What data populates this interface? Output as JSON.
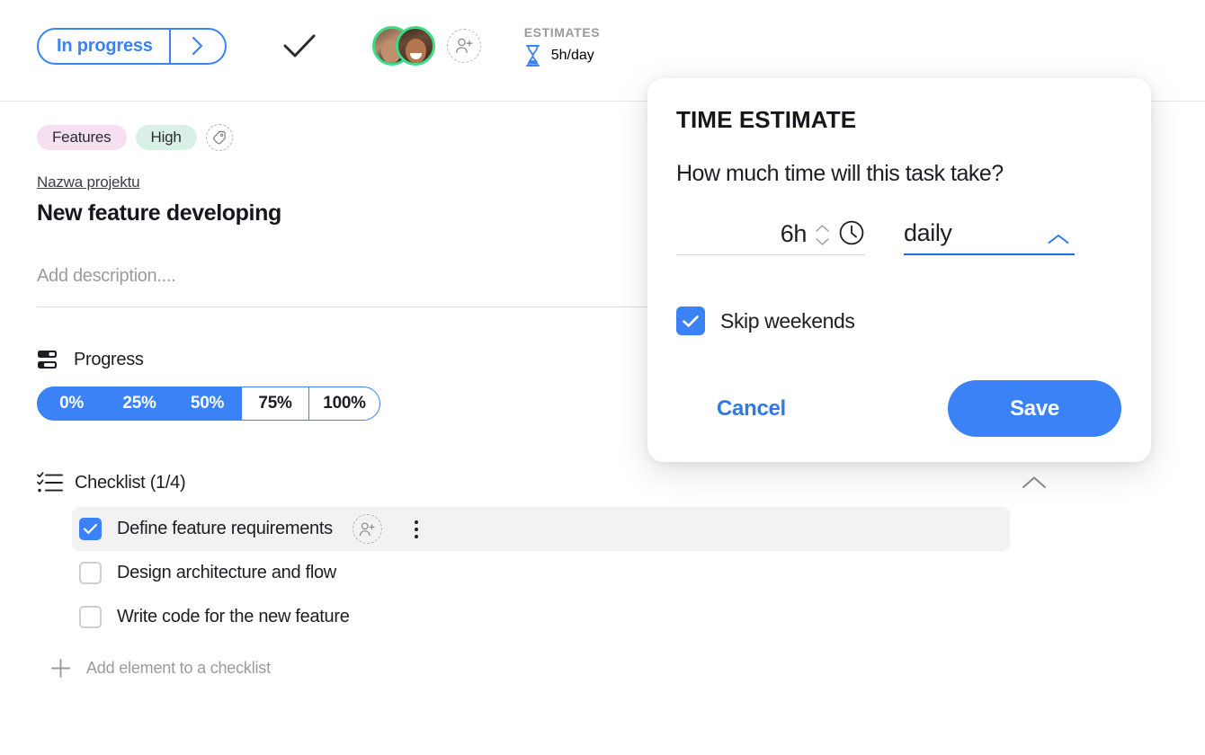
{
  "header": {
    "status_label": "In progress",
    "status_next_icon": "chevron-right-icon",
    "complete_icon": "checkmark-icon",
    "add_person_icon": "add-person-icon",
    "estimates_label": "ESTIMATES",
    "estimates_icon": "hourglass-icon",
    "estimates_value": "5h/day",
    "accent_color": "#3b82f6"
  },
  "task": {
    "tags": [
      {
        "label": "Features",
        "color": "#f5dff0"
      },
      {
        "label": "High",
        "color": "#d9f0e6"
      }
    ],
    "add_tag_icon": "tag-icon",
    "project_link": "Nazwa projektu",
    "title": "New feature developing",
    "description_placeholder": "Add description...."
  },
  "progress": {
    "icon": "progress-bars-icon",
    "title": "Progress",
    "segments": [
      {
        "label": "0%",
        "selected": true
      },
      {
        "label": "25%",
        "selected": true
      },
      {
        "label": "50%",
        "selected": true
      },
      {
        "label": "75%",
        "selected": false
      },
      {
        "label": "100%",
        "selected": false
      }
    ]
  },
  "checklist": {
    "icon": "checklist-icon",
    "title": "Checklist (1/4)",
    "collapse_icon": "chevron-up-icon",
    "items": [
      {
        "label": "Define feature requirements",
        "checked": true,
        "active": true
      },
      {
        "label": "Design architecture and flow",
        "checked": false,
        "active": false
      },
      {
        "label": "Write code for the new feature",
        "checked": false,
        "active": false
      }
    ],
    "item_assign_icon": "add-person-icon",
    "item_more_icon": "more-vertical-icon",
    "add_icon": "plus-icon",
    "add_label": "Add element to a checklist"
  },
  "modal": {
    "title": "TIME ESTIMATE",
    "question": "How much time will this task take?",
    "hours_value": "6h",
    "hours_stepper_icon": "stepper-up-down-icon",
    "clock_icon": "clock-icon",
    "frequency_value": "daily",
    "frequency_chevron_icon": "chevron-up-icon",
    "skip_weekends_label": "Skip weekends",
    "skip_weekends_checked": true,
    "cancel_label": "Cancel",
    "save_label": "Save",
    "accent_color": "#3b82f6"
  }
}
